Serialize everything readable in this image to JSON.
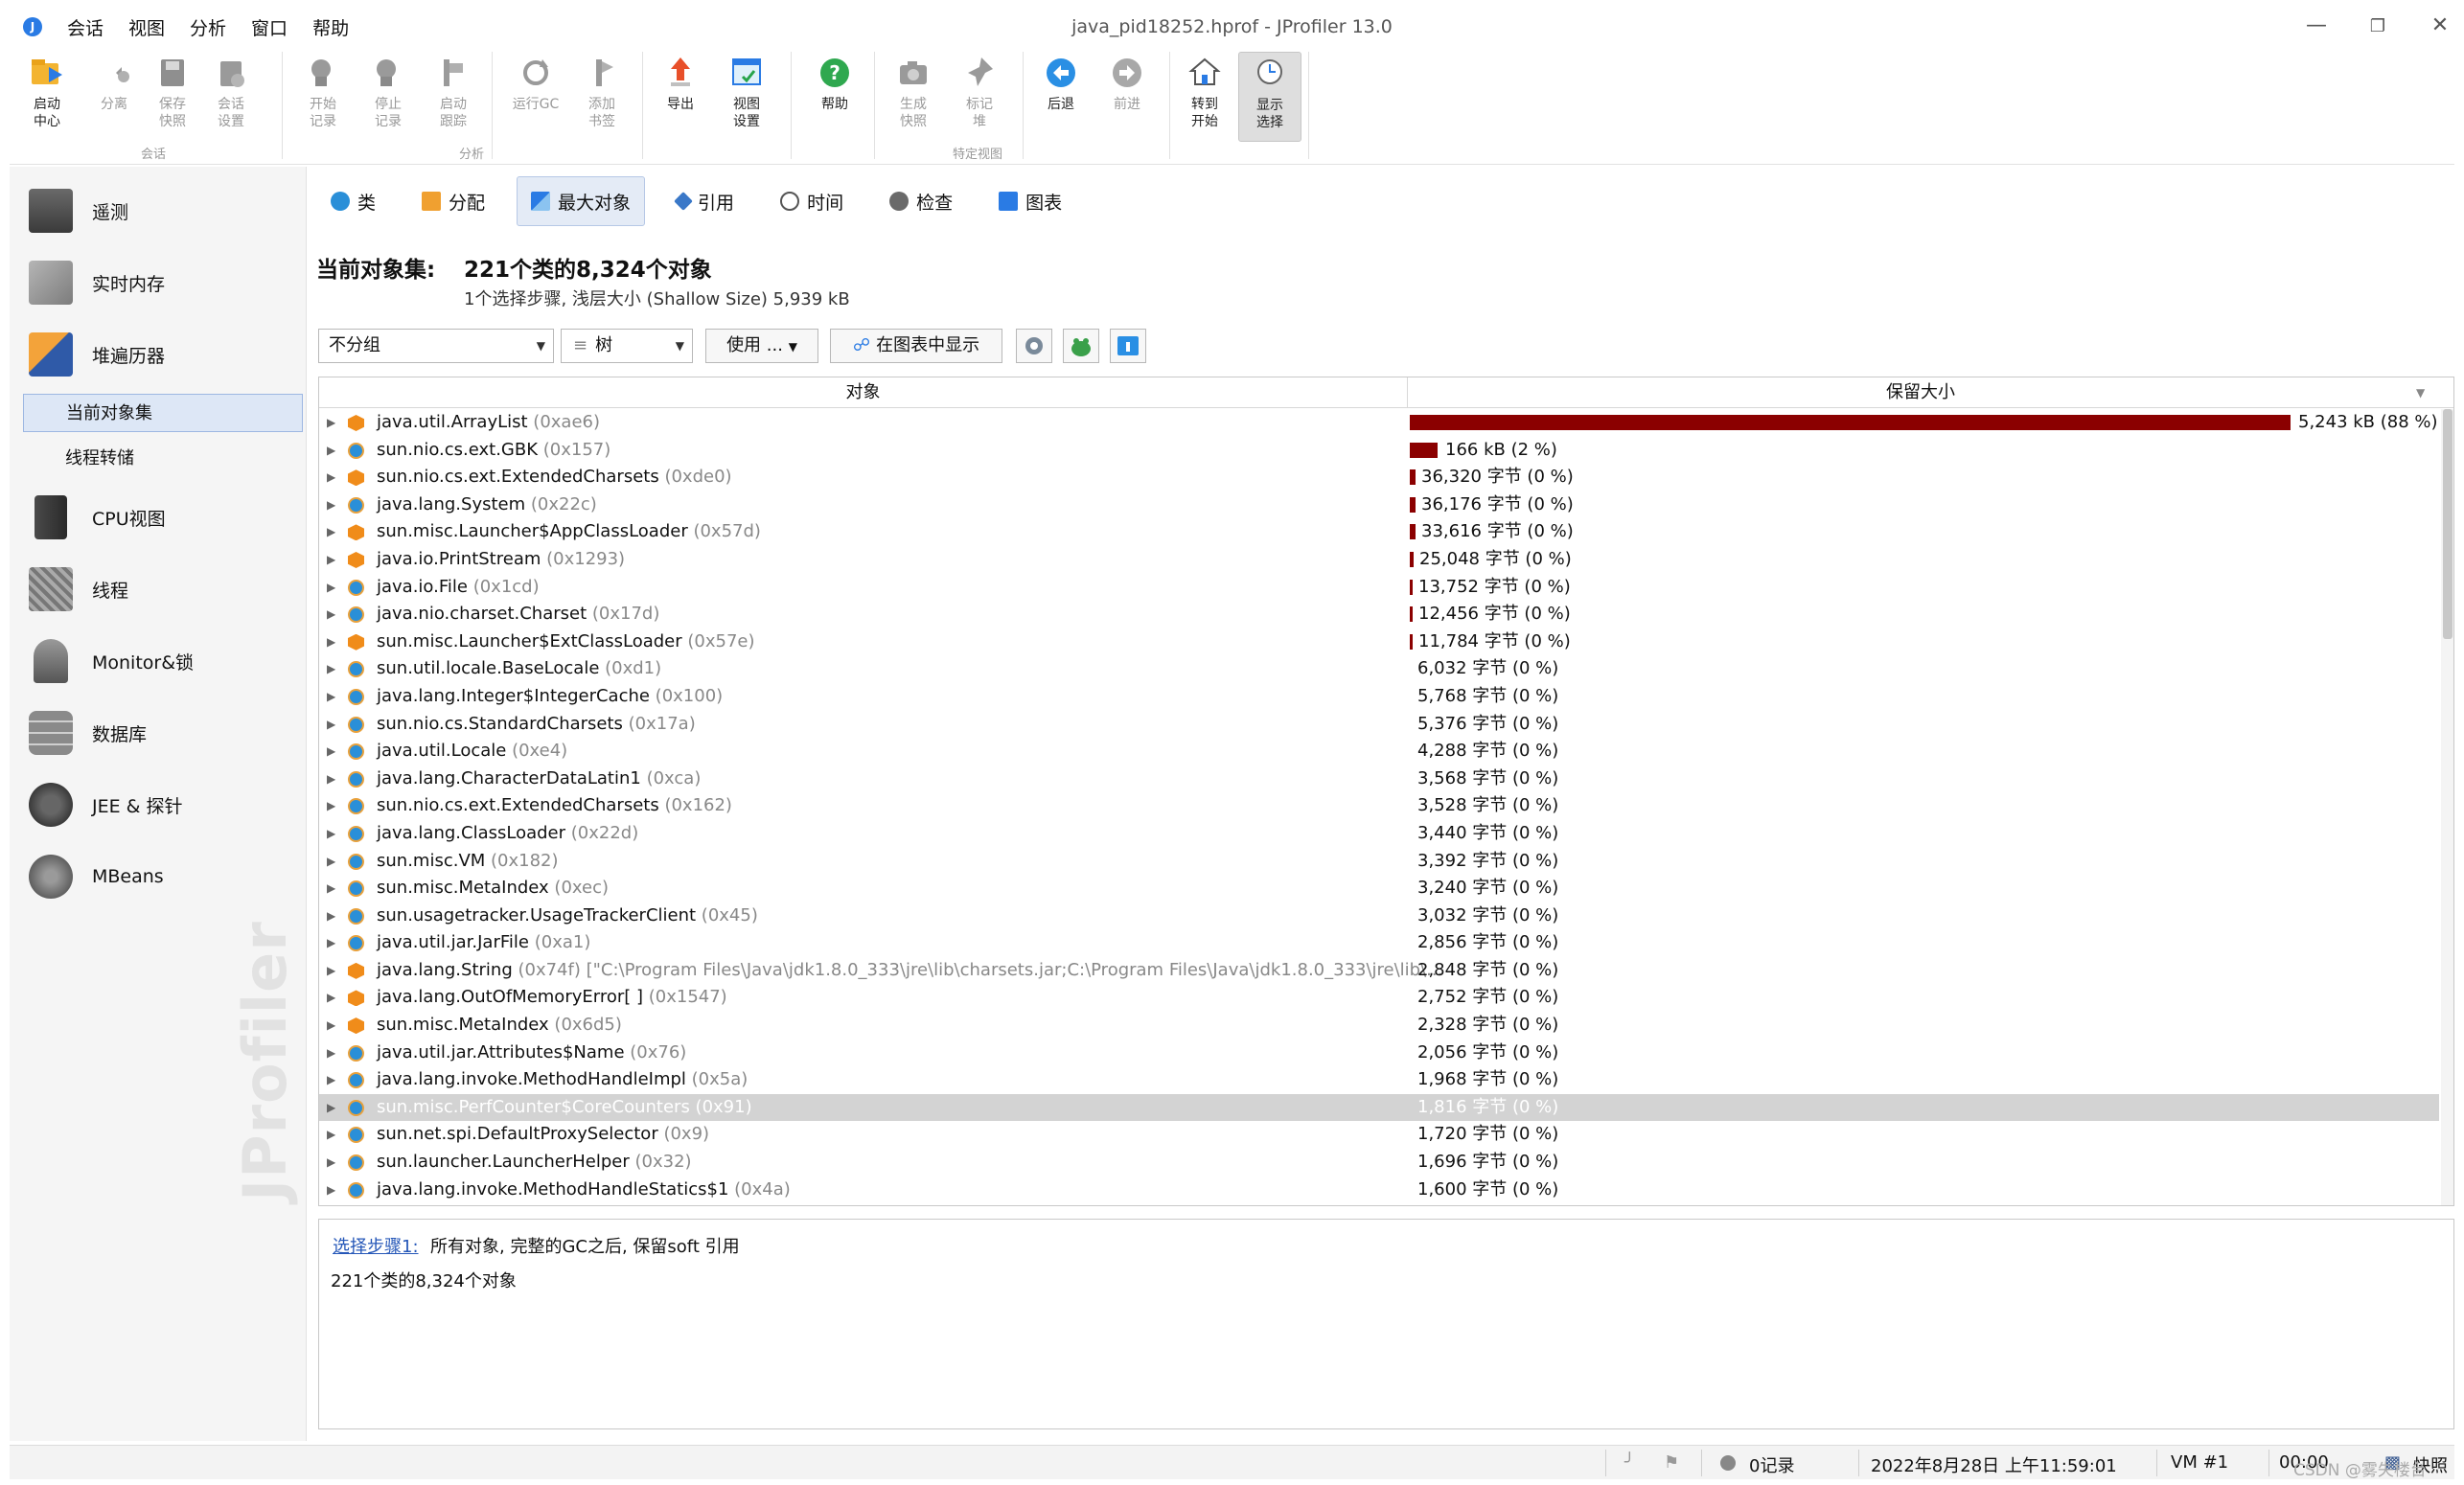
{
  "window": {
    "title": "java_pid18252.hprof - JProfiler 13.0",
    "menu": [
      "会话",
      "视图",
      "分析",
      "窗口",
      "帮助"
    ]
  },
  "ribbon": {
    "buttons": [
      {
        "label": "启动\n中心",
        "icon": "launch-center-icon"
      },
      {
        "label": "分离",
        "icon": "detach-icon"
      },
      {
        "label": "保存\n快照",
        "icon": "save-snapshot-icon"
      },
      {
        "label": "会话\n设置",
        "icon": "session-settings-icon"
      },
      {
        "label": "开始\n记录",
        "icon": "start-recording-icon"
      },
      {
        "label": "停止\n记录",
        "icon": "stop-recording-icon"
      },
      {
        "label": "启动\n跟踪",
        "icon": "start-tracking-icon"
      },
      {
        "label": "运行GC",
        "icon": "run-gc-icon"
      },
      {
        "label": "添加\n书签",
        "icon": "add-bookmark-icon"
      },
      {
        "label": "导出",
        "icon": "export-icon"
      },
      {
        "label": "视图\n设置",
        "icon": "view-settings-icon"
      },
      {
        "label": "帮助",
        "icon": "help-icon"
      },
      {
        "label": "生成\n快照",
        "icon": "create-snapshot-icon"
      },
      {
        "label": "标记\n堆",
        "icon": "mark-heap-icon"
      },
      {
        "label": "后退",
        "icon": "back-icon"
      },
      {
        "label": "前进",
        "icon": "forward-icon"
      },
      {
        "label": "转到\n开始",
        "icon": "go-to-start-icon"
      },
      {
        "label": "显示\n选择",
        "icon": "show-selection-icon"
      }
    ],
    "groups": [
      "会话",
      "分析",
      "特定视图"
    ]
  },
  "sidebar": {
    "items": [
      {
        "label": "遥测",
        "icon": "telemetry-icon"
      },
      {
        "label": "实时内存",
        "icon": "live-memory-icon"
      },
      {
        "label": "堆遍历器",
        "icon": "heap-walker-icon"
      },
      {
        "label": "CPU视图",
        "icon": "cpu-views-icon"
      },
      {
        "label": "线程",
        "icon": "threads-icon"
      },
      {
        "label": "Monitor&锁",
        "icon": "monitors-locks-icon"
      },
      {
        "label": "数据库",
        "icon": "database-icon"
      },
      {
        "label": "JEE & 探针",
        "icon": "jee-probes-icon"
      },
      {
        "label": "MBeans",
        "icon": "mbeans-icon"
      }
    ],
    "subitems": [
      "当前对象集",
      "线程转储"
    ],
    "brand": "JProfiler"
  },
  "tabs": [
    {
      "label": "类",
      "icon": "classes-icon"
    },
    {
      "label": "分配",
      "icon": "allocations-icon"
    },
    {
      "label": "最大对象",
      "icon": "biggest-objects-icon"
    },
    {
      "label": "引用",
      "icon": "references-icon"
    },
    {
      "label": "时间",
      "icon": "time-icon"
    },
    {
      "label": "检查",
      "icon": "inspections-icon"
    },
    {
      "label": "图表",
      "icon": "graph-icon"
    }
  ],
  "objectSet": {
    "label": "当前对象集:",
    "value": "221个类的8,324个对象",
    "sub": "1个选择步骤, 浅层大小 (Shallow Size) 5,939 kB"
  },
  "controls": {
    "grouping": "不分组",
    "view": "树",
    "use": "使用 ...",
    "showInGraph": "在图表中显示",
    "icons": [
      "settings-icon",
      "frog-icon",
      "info-icon"
    ]
  },
  "table": {
    "headers": {
      "object": "对象",
      "retained": "保留大小"
    },
    "rows": [
      {
        "name": "java.util.ArrayList",
        "addr": " (0xae6)",
        "type": "obj",
        "size": "5,243 kB (88 %)",
        "pct": 88.0
      },
      {
        "name": "sun.nio.cs.ext.GBK",
        "addr": " (0x157)",
        "type": "cls",
        "size": "166 kB (2 %)",
        "pct": 2.8
      },
      {
        "name": "sun.nio.cs.ext.ExtendedCharsets",
        "addr": " (0xde0)",
        "type": "obj",
        "size": "36,320 字节 (0 %)",
        "pct": 0.6
      },
      {
        "name": "java.lang.System",
        "addr": " (0x22c)",
        "type": "cls",
        "size": "36,176 字节 (0 %)",
        "pct": 0.6
      },
      {
        "name": "sun.misc.Launcher$AppClassLoader",
        "addr": " (0x57d)",
        "type": "obj",
        "size": "33,616 字节 (0 %)",
        "pct": 0.55
      },
      {
        "name": "java.io.PrintStream",
        "addr": " (0x1293)",
        "type": "obj",
        "size": "25,048 字节 (0 %)",
        "pct": 0.42
      },
      {
        "name": "java.io.File",
        "addr": " (0x1cd)",
        "type": "cls",
        "size": "13,752 字节 (0 %)",
        "pct": 0.23
      },
      {
        "name": "java.nio.charset.Charset",
        "addr": " (0x17d)",
        "type": "cls",
        "size": "12,456 字节 (0 %)",
        "pct": 0.21
      },
      {
        "name": "sun.misc.Launcher$ExtClassLoader",
        "addr": " (0x57e)",
        "type": "obj",
        "size": "11,784 字节 (0 %)",
        "pct": 0.2
      },
      {
        "name": "sun.util.locale.BaseLocale",
        "addr": " (0xd1)",
        "type": "cls",
        "size": "6,032 字节 (0 %)",
        "pct": 0
      },
      {
        "name": "java.lang.Integer$IntegerCache",
        "addr": " (0x100)",
        "type": "cls",
        "size": "5,768 字节 (0 %)",
        "pct": 0
      },
      {
        "name": "sun.nio.cs.StandardCharsets",
        "addr": " (0x17a)",
        "type": "cls",
        "size": "5,376 字节 (0 %)",
        "pct": 0
      },
      {
        "name": "java.util.Locale",
        "addr": " (0xe4)",
        "type": "cls",
        "size": "4,288 字节 (0 %)",
        "pct": 0
      },
      {
        "name": "java.lang.CharacterDataLatin1",
        "addr": " (0xca)",
        "type": "cls",
        "size": "3,568 字节 (0 %)",
        "pct": 0
      },
      {
        "name": "sun.nio.cs.ext.ExtendedCharsets",
        "addr": " (0x162)",
        "type": "cls",
        "size": "3,528 字节 (0 %)",
        "pct": 0
      },
      {
        "name": "java.lang.ClassLoader",
        "addr": " (0x22d)",
        "type": "cls",
        "size": "3,440 字节 (0 %)",
        "pct": 0
      },
      {
        "name": "sun.misc.VM",
        "addr": " (0x182)",
        "type": "cls",
        "size": "3,392 字节 (0 %)",
        "pct": 0
      },
      {
        "name": "sun.misc.MetaIndex",
        "addr": " (0xec)",
        "type": "cls",
        "size": "3,240 字节 (0 %)",
        "pct": 0
      },
      {
        "name": "sun.usagetracker.UsageTrackerClient",
        "addr": " (0x45)",
        "type": "cls",
        "size": "3,032 字节 (0 %)",
        "pct": 0
      },
      {
        "name": "java.util.jar.JarFile",
        "addr": " (0xa1)",
        "type": "cls",
        "size": "2,856 字节 (0 %)",
        "pct": 0
      },
      {
        "name": "java.lang.String",
        "addr": " (0x74f) [\"C:\\Program Files\\Java\\jdk1.8.0_333\\jre\\lib\\charsets.jar;C:\\Program Files\\Java\\jdk1.8.0_333\\jre\\lib\\...",
        "type": "obj",
        "size": "2,848 字节 (0 %)",
        "pct": 0
      },
      {
        "name": "java.lang.OutOfMemoryError[ ]",
        "addr": " (0x1547)",
        "type": "obj",
        "size": "2,752 字节 (0 %)",
        "pct": 0
      },
      {
        "name": "sun.misc.MetaIndex",
        "addr": " (0x6d5)",
        "type": "obj",
        "size": "2,328 字节 (0 %)",
        "pct": 0
      },
      {
        "name": "java.util.jar.Attributes$Name",
        "addr": " (0x76)",
        "type": "cls",
        "size": "2,056 字节 (0 %)",
        "pct": 0
      },
      {
        "name": "java.lang.invoke.MethodHandleImpl",
        "addr": " (0x5a)",
        "type": "cls",
        "size": "1,968 字节 (0 %)",
        "pct": 0
      },
      {
        "name": "sun.misc.PerfCounter$CoreCounters",
        "addr": " (0x91)",
        "type": "cls",
        "size": "1,816 字节 (0 %)",
        "pct": 0,
        "selected": true
      },
      {
        "name": "sun.net.spi.DefaultProxySelector",
        "addr": " (0x9)",
        "type": "cls",
        "size": "1,720 字节 (0 %)",
        "pct": 0
      },
      {
        "name": "sun.launcher.LauncherHelper",
        "addr": " (0x32)",
        "type": "cls",
        "size": "1,696 字节 (0 %)",
        "pct": 0
      },
      {
        "name": "java.lang.invoke.MethodHandleStatics$1",
        "addr": " (0x4a)",
        "type": "cls",
        "size": "1,600 字节 (0 %)",
        "pct": 0
      }
    ]
  },
  "bottom": {
    "stepLink": "选择步骤1:",
    "stepDesc": "所有对象, 完整的GC之后, 保留soft 引用",
    "result": "221个类的8,324个对象"
  },
  "status": {
    "records": "0记录",
    "datetime": "2022年8月28日 上午11:59:01",
    "vm": "VM #1",
    "time": "00:00",
    "snapshot": "快照",
    "watermark": "CSDN @雾失楼台"
  }
}
